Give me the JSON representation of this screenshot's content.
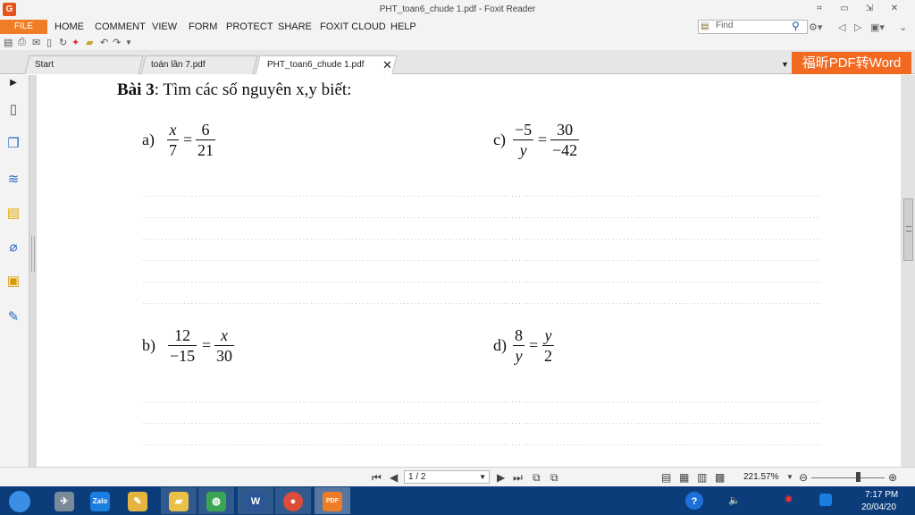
{
  "window": {
    "title": "PHT_toan6_chude 1.pdf - Foxit Reader",
    "logo_glyph": "G"
  },
  "menu": {
    "file": "FILE",
    "items": [
      "HOME",
      "COMMENT",
      "VIEW",
      "FORM",
      "PROTECT",
      "SHARE",
      "FOXIT CLOUD",
      "HELP"
    ]
  },
  "search": {
    "placeholder": "Find"
  },
  "tabs": [
    {
      "label": "Start"
    },
    {
      "label": "toán lần 7.pdf"
    },
    {
      "label": "PHT_toan6_chude 1.pdf",
      "active": true
    }
  ],
  "ad_banner": "福昕PDF转Word",
  "document": {
    "title_bold": "Bài 3",
    "title_rest": ": Tìm các số nguyên x,y biết:",
    "problems": {
      "a": {
        "label": "a)",
        "num1": "x",
        "den1": "7",
        "num2": "6",
        "den2": "21"
      },
      "c": {
        "label": "c)",
        "num1": "−5",
        "den1": "y",
        "num2": "30",
        "den2": "−42"
      },
      "b": {
        "label": "b)",
        "num1": "12",
        "den1": "−15",
        "num2": "x",
        "den2": "30"
      },
      "d": {
        "label": "d)",
        "num1": "8",
        "den1": "y",
        "num2": "y",
        "den2": "2"
      }
    },
    "equals": "=",
    "dotted_line": "……………………………………………………………………………………………………………………………………………………………………………………"
  },
  "status": {
    "page": "1 / 2",
    "zoom": "221.57%"
  },
  "taskbar": {
    "apps": [
      "start",
      "app-2",
      "zalo",
      "paint",
      "explorer",
      "coccoc",
      "word",
      "chrome",
      "foxit"
    ],
    "zalo_label": "Zalo",
    "word_label": "W",
    "foxit_label": "PDF",
    "help_label": "?",
    "time": "7:17 PM",
    "date": "20/04/20"
  },
  "colors": {
    "accent_orange": "#f07c26",
    "banner_orange": "#f26a21",
    "taskbar_blue": "#0c3d7a"
  }
}
